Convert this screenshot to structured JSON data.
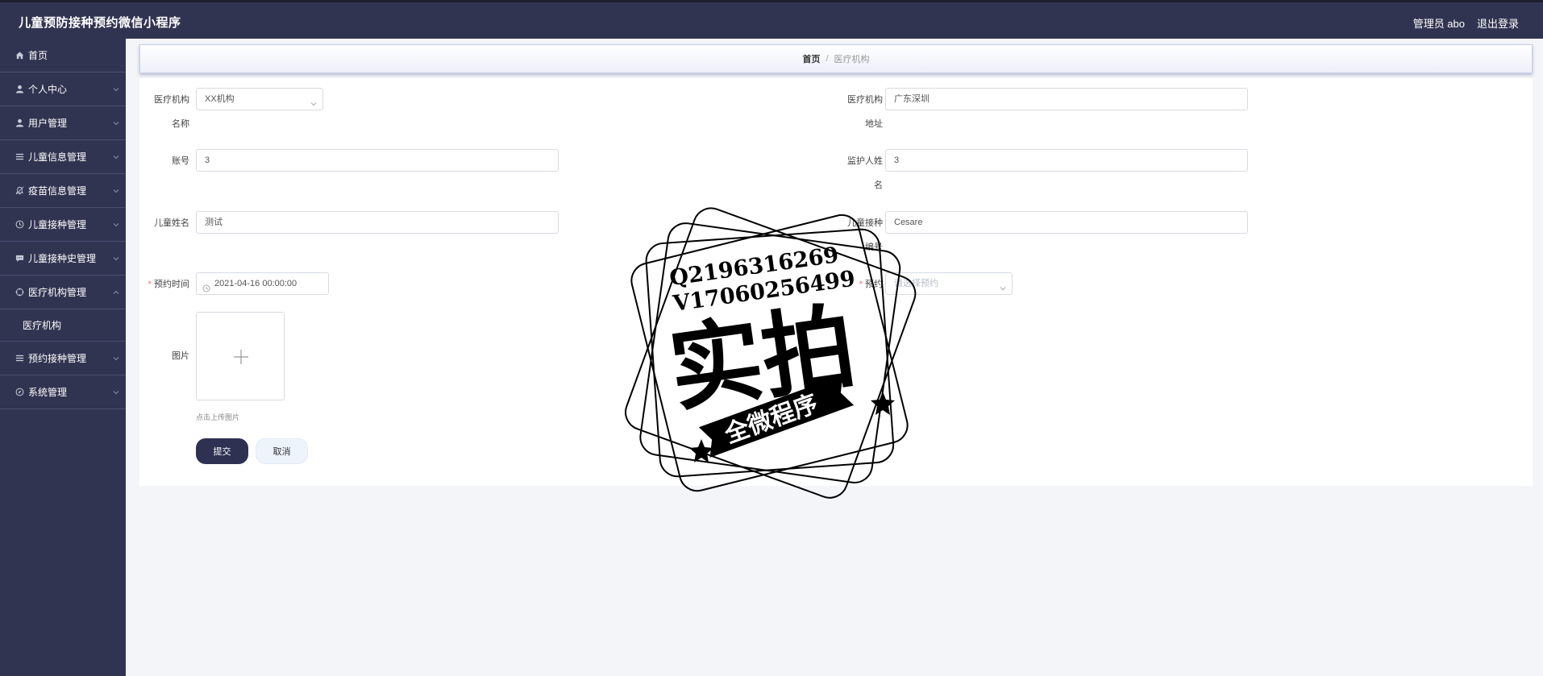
{
  "header": {
    "title": "儿童预防接种预约微信小程序",
    "admin": "管理员 abo",
    "logout": "退出登录"
  },
  "sidebar": {
    "items": [
      {
        "label": "首页",
        "icon": "home-icon"
      },
      {
        "label": "个人中心",
        "icon": "user-icon"
      },
      {
        "label": "用户管理",
        "icon": "user-icon"
      },
      {
        "label": "儿童信息管理",
        "icon": "list-icon"
      },
      {
        "label": "疫苗信息管理",
        "icon": "bell-icon"
      },
      {
        "label": "儿童接种管理",
        "icon": "clock-icon"
      },
      {
        "label": "儿童接种史管理",
        "icon": "chat-icon"
      },
      {
        "label": "医疗机构管理",
        "icon": "crosshair-icon"
      },
      {
        "label": "预约接种管理",
        "icon": "list-icon"
      },
      {
        "label": "系统管理",
        "icon": "compass-icon"
      }
    ],
    "sub_item": "医疗机构"
  },
  "breadcrumb": {
    "home": "首页",
    "separator": "/",
    "current": "医疗机构"
  },
  "form": {
    "org_name_label_1": "医疗机构",
    "org_name_label_2": "名称",
    "org_name_value": "XX机构",
    "org_addr_label_1": "医疗机构",
    "org_addr_label_2": "地址",
    "org_addr_value": "广东深圳",
    "account_label": "账号",
    "account_value": "3",
    "guardian_label_1": "监护人姓",
    "guardian_label_2": "名",
    "guardian_value": "3",
    "child_name_label": "儿童姓名",
    "child_name_value": "测试",
    "child_no_label_1": "儿童接种",
    "child_no_label_2": "编号",
    "child_no_value": "Cesare",
    "appt_time_required": "*",
    "appt_time_label": "预约时间",
    "appt_time_value": "2021-04-16 00:00:00",
    "appt_required": "*",
    "appt_label": "预约",
    "appt_placeholder": "请选择预约",
    "image_label": "图片",
    "upload_hint": "点击上传图片",
    "submit": "提交",
    "cancel": "取消"
  },
  "watermark": {
    "line1": "Q2196316269",
    "line2": "V17060256499",
    "main": "实拍",
    "banner": "全微程序"
  },
  "colors": {
    "header_bg": "#313451",
    "sidebar_bg": "#313451",
    "submit_bg": "#2e3152",
    "content_bg": "#f4f5f9"
  }
}
